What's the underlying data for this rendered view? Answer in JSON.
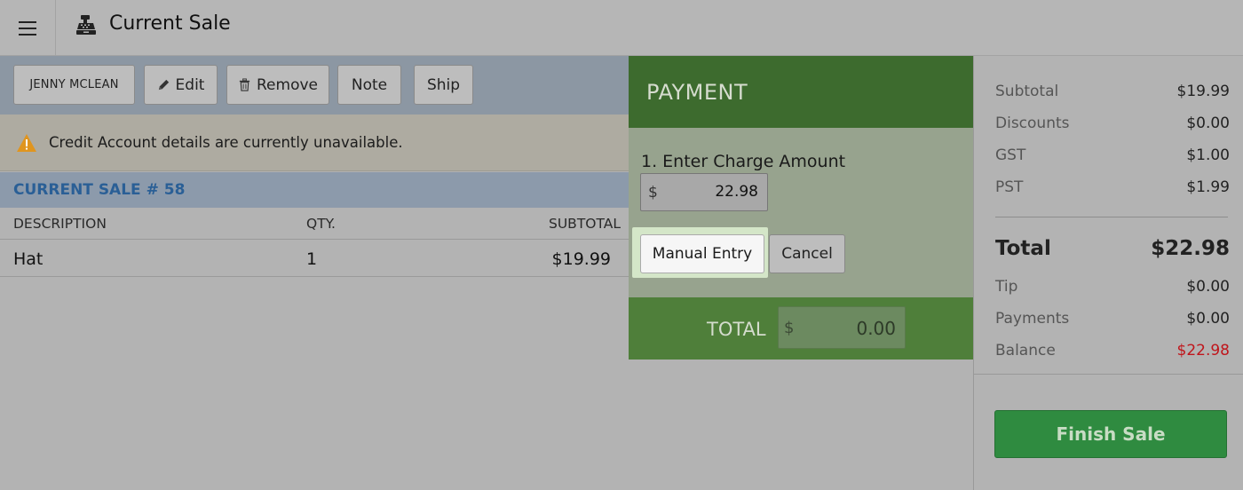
{
  "header": {
    "title": "Current Sale",
    "menu_icon": "hamburger-icon",
    "title_icon": "cash-register-icon"
  },
  "customer_bar": {
    "customer_name": "JENNY MCLEAN",
    "edit_label": "Edit",
    "remove_label": "Remove",
    "note_label": "Note",
    "ship_label": "Ship"
  },
  "alert": {
    "icon": "warning-icon",
    "text": "Credit Account details are currently unavailable."
  },
  "sale": {
    "header": "CURRENT SALE # 58",
    "columns": {
      "description": "DESCRIPTION",
      "qty": "QTY.",
      "subtotal": "SUBTOTAL"
    },
    "items": [
      {
        "description": "Hat",
        "qty": "1",
        "subtotal": "$19.99"
      }
    ]
  },
  "payment": {
    "heading": "PAYMENT",
    "step_label": "1. Enter Charge Amount",
    "currency": "$",
    "charge_amount": "22.98",
    "manual_entry_label": "Manual Entry",
    "cancel_label": "Cancel",
    "total_label": "TOTAL",
    "total_currency": "$",
    "total_value": "0.00"
  },
  "summary": {
    "subtotal_label": "Subtotal",
    "subtotal": "$19.99",
    "discounts_label": "Discounts",
    "discounts": "$0.00",
    "gst_label": "GST",
    "gst": "$1.00",
    "pst_label": "PST",
    "pst": "$1.99",
    "total_label": "Total",
    "total": "$22.98",
    "tip_label": "Tip",
    "tip": "$0.00",
    "payments_label": "Payments",
    "payments": "$0.00",
    "balance_label": "Balance",
    "balance": "$22.98",
    "finish_label": "Finish Sale"
  },
  "colors": {
    "payment_header": "#3d6b2e",
    "payment_total_bar": "#4f7f3a",
    "finish_button": "#2f8b40",
    "balance_red": "#c0151b",
    "sale_header_text": "#2a5f96",
    "warning": "#e0951f"
  }
}
